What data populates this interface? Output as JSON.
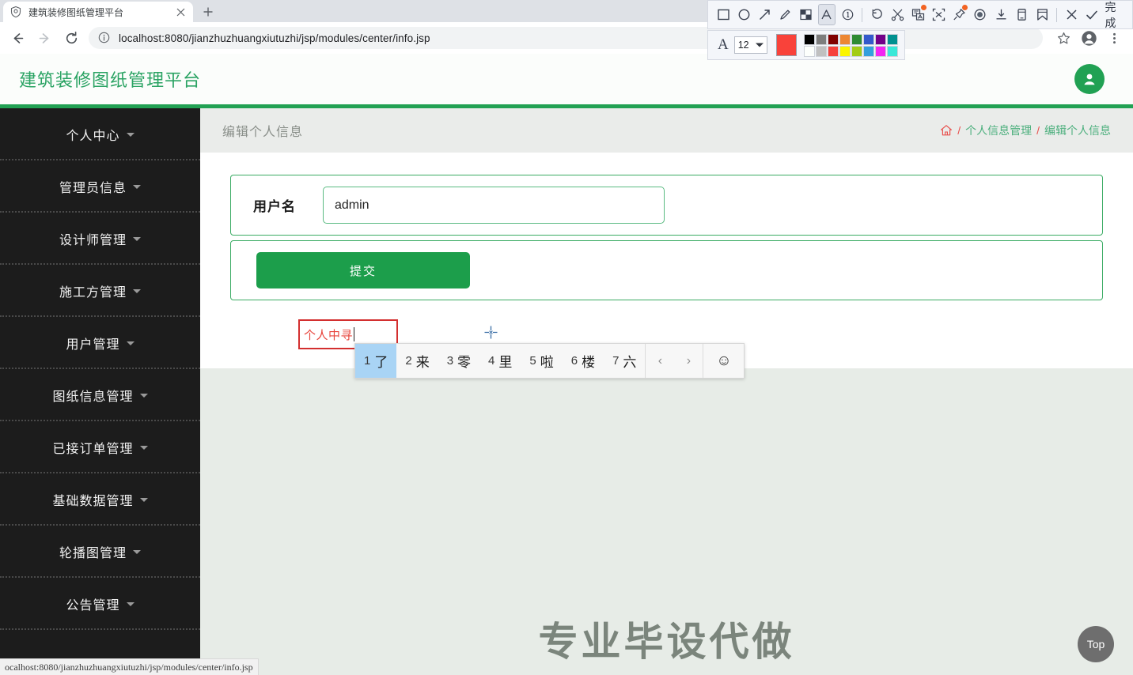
{
  "browser": {
    "tab": {
      "title": "建筑装修图纸管理平台",
      "favicon_icon": "shield-icon",
      "close_icon": "close-icon"
    },
    "new_tab_label": "+",
    "back_icon": "back-arrow-icon",
    "forward_icon": "forward-arrow-icon",
    "reload_icon": "reload-icon",
    "info_icon": "info-circle-icon",
    "url": "localhost:8080/jianzhuzhuangxiutuzhi/jsp/modules/center/info.jsp",
    "bookmark_icon": "star-icon",
    "profile_icon": "profile-avatar-icon",
    "menu_icon": "three-dot-menu-icon",
    "status_text": "ocalhost:8080/jianzhuzhuangxiutuzhi/jsp/modules/center/info.jsp"
  },
  "annotation_toolbar": {
    "tools": [
      {
        "name": "rectangle-tool-icon",
        "active": false
      },
      {
        "name": "ellipse-tool-icon",
        "active": false
      },
      {
        "name": "arrow-tool-icon",
        "active": false
      },
      {
        "name": "pencil-tool-icon",
        "active": false
      },
      {
        "name": "mosaic-tool-icon",
        "active": false
      },
      {
        "name": "text-tool-icon",
        "active": true
      },
      {
        "name": "number-marker-tool-icon",
        "active": false
      }
    ],
    "actions": [
      {
        "name": "undo-icon",
        "badge": false
      },
      {
        "name": "scissors-crop-icon",
        "badge": false
      },
      {
        "name": "ocr-translate-icon",
        "badge": true
      },
      {
        "name": "extract-selection-icon",
        "badge": false
      },
      {
        "name": "pin-icon",
        "badge": true
      },
      {
        "name": "record-icon",
        "badge": false
      },
      {
        "name": "download-icon",
        "badge": false
      },
      {
        "name": "save-to-device-icon",
        "badge": false
      },
      {
        "name": "bookmark-collect-icon",
        "badge": false
      }
    ],
    "cancel_icon": "close-x-icon",
    "confirm_icon": "check-icon",
    "done_label": "完成"
  },
  "annotation_style": {
    "font_icon": "font-size-icon",
    "font_size": "12",
    "current_color": "#f9423a",
    "palette_row1": [
      "#000000",
      "#7d7d7d",
      "#800000",
      "#ed8733",
      "#2e8b33",
      "#3359cc",
      "#720089",
      "#009090"
    ],
    "palette_row2": [
      "#fdfffc",
      "#c0c0c0",
      "#f6403c",
      "#fbf500",
      "#a3cc16",
      "#339fdd",
      "#f225f2",
      "#39e8d8"
    ]
  },
  "page": {
    "brand": "建筑装修图纸管理平台",
    "avatar_icon": "user-avatar-icon",
    "content_title": "编辑个人信息",
    "breadcrumb": {
      "home_icon": "home-icon",
      "separator": "/",
      "parent": "个人信息管理",
      "current": "编辑个人信息"
    },
    "sidebar": [
      {
        "label": "个人中心",
        "caret_icon": "chevron-down-icon"
      },
      {
        "label": "管理员信息",
        "caret_icon": "chevron-down-icon"
      },
      {
        "label": "设计师管理",
        "caret_icon": "chevron-down-icon"
      },
      {
        "label": "施工方管理",
        "caret_icon": "chevron-down-icon"
      },
      {
        "label": "用户管理",
        "caret_icon": "chevron-down-icon"
      },
      {
        "label": "图纸信息管理",
        "caret_icon": "chevron-down-icon"
      },
      {
        "label": "已接订单管理",
        "caret_icon": "chevron-down-icon"
      },
      {
        "label": "基础数据管理",
        "caret_icon": "chevron-down-icon"
      },
      {
        "label": "轮播图管理",
        "caret_icon": "chevron-down-icon"
      },
      {
        "label": "公告管理",
        "caret_icon": "chevron-down-icon"
      }
    ],
    "form": {
      "username_label": "用户名",
      "username_value": "admin",
      "username_placeholder": "用户名",
      "submit_label": "提交"
    },
    "watermark": "专业毕设代做",
    "top_button_label": "Top"
  },
  "ime": {
    "composing_text": "个人中寻",
    "candidates": [
      {
        "num": "1",
        "word": "了",
        "selected": true
      },
      {
        "num": "2",
        "word": "来",
        "selected": false
      },
      {
        "num": "3",
        "word": "零",
        "selected": false
      },
      {
        "num": "4",
        "word": "里",
        "selected": false
      },
      {
        "num": "5",
        "word": "啦",
        "selected": false
      },
      {
        "num": "6",
        "word": "楼",
        "selected": false
      },
      {
        "num": "7",
        "word": "六",
        "selected": false
      }
    ],
    "prev_icon": "chevron-left-icon",
    "next_icon": "chevron-right-icon",
    "emoji_icon": "smiley-icon"
  }
}
